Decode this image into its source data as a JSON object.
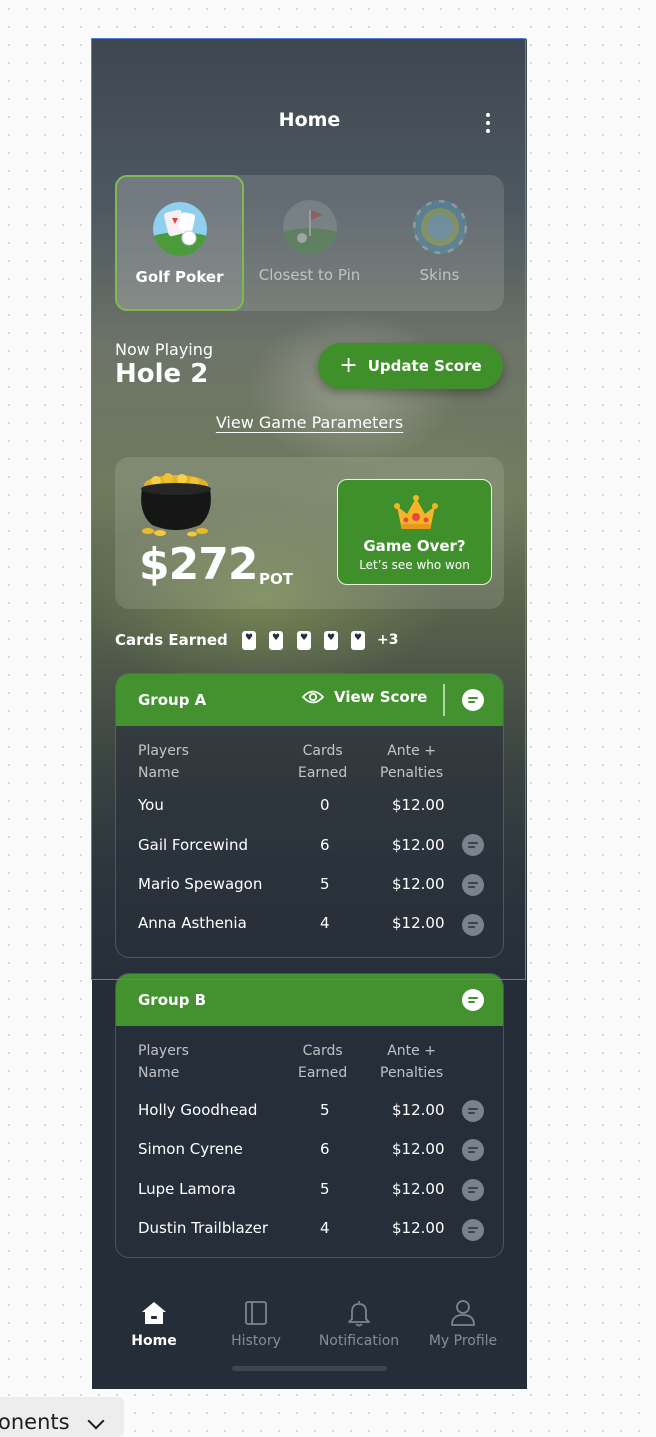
{
  "header": {
    "title": "Home"
  },
  "game_tabs": [
    {
      "label": "Golf Poker",
      "icon": "golf-poker-icon",
      "active": true
    },
    {
      "label": "Closest to Pin",
      "icon": "closest-to-pin-icon",
      "active": false
    },
    {
      "label": "Skins",
      "icon": "skins-chip-icon",
      "active": false
    }
  ],
  "status": {
    "now_playing": "Now Playing",
    "hole": "Hole 2"
  },
  "update_button": {
    "label": "Update Score",
    "icon": "plus-icon"
  },
  "params_link": "View Game Parameters",
  "pot": {
    "amount": "$272",
    "label": "POT",
    "icon": "pot-of-gold-icon"
  },
  "game_over": {
    "title": "Game Over?",
    "subtitle": "Let’s see who won",
    "icon": "crown-icon"
  },
  "cards_earned": {
    "label": "Cards Earned",
    "card_icons": 5,
    "more": "+3"
  },
  "columns": {
    "name": "Players\nName",
    "cards": "Cards\nEarned",
    "ante": "Ante +\nPenalties"
  },
  "groups": [
    {
      "name": "Group A",
      "view_score": "View Score",
      "rows": [
        {
          "name": "You",
          "cards": "0",
          "ante": "$12.00",
          "chat": false
        },
        {
          "name": "Gail Forcewind",
          "cards": "6",
          "ante": "$12.00",
          "chat": true
        },
        {
          "name": "Mario Spewagon",
          "cards": "5",
          "ante": "$12.00",
          "chat": true
        },
        {
          "name": "Anna Asthenia",
          "cards": "4",
          "ante": "$12.00",
          "chat": true
        }
      ]
    },
    {
      "name": "Group B",
      "rows": [
        {
          "name": "Holly Goodhead",
          "cards": "5",
          "ante": "$12.00",
          "chat": true
        },
        {
          "name": "Simon Cyrene",
          "cards": "6",
          "ante": "$12.00",
          "chat": true
        },
        {
          "name": "Lupe Lamora",
          "cards": "5",
          "ante": "$12.00",
          "chat": true
        },
        {
          "name": "Dustin Trailblazer",
          "cards": "4",
          "ante": "$12.00",
          "chat": true
        }
      ]
    }
  ],
  "nav": [
    {
      "label": "Home",
      "icon": "home-icon",
      "active": true
    },
    {
      "label": "History",
      "icon": "history-icon",
      "active": false
    },
    {
      "label": "Notification",
      "icon": "bell-icon",
      "active": false
    },
    {
      "label": "My Profile",
      "icon": "profile-icon",
      "active": false
    }
  ],
  "canvas_tab": {
    "label": "onents"
  },
  "colors": {
    "accent_green": "#43922f",
    "dark_bg": "#252d38",
    "selection_blue": "#4c7de0"
  }
}
